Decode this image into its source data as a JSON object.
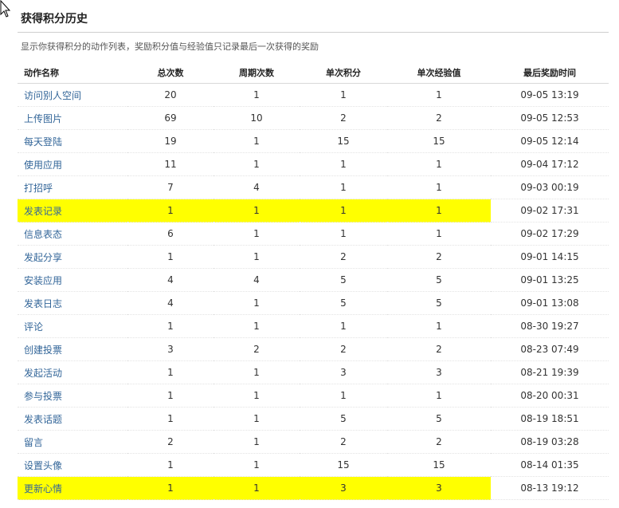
{
  "page": {
    "title": "获得积分历史",
    "subtitle": "显示你获得积分的动作列表，奖励积分值与经验值只记录最后一次获得的奖励"
  },
  "table": {
    "headers": {
      "action": "动作名称",
      "total": "总次数",
      "cycle": "周期次数",
      "points": "单次积分",
      "exp": "单次经验值",
      "last_time": "最后奖励时间"
    },
    "rows": [
      {
        "action": "访问别人空间",
        "total": "20",
        "cycle": "1",
        "points": "1",
        "exp": "1",
        "last_time": "09-05 13:19",
        "highlight": false
      },
      {
        "action": "上传图片",
        "total": "69",
        "cycle": "10",
        "points": "2",
        "exp": "2",
        "last_time": "09-05 12:53",
        "highlight": false
      },
      {
        "action": "每天登陆",
        "total": "19",
        "cycle": "1",
        "points": "15",
        "exp": "15",
        "last_time": "09-05 12:14",
        "highlight": false
      },
      {
        "action": "使用应用",
        "total": "11",
        "cycle": "1",
        "points": "1",
        "exp": "1",
        "last_time": "09-04 17:12",
        "highlight": false
      },
      {
        "action": "打招呼",
        "total": "7",
        "cycle": "4",
        "points": "1",
        "exp": "1",
        "last_time": "09-03 00:19",
        "highlight": false
      },
      {
        "action": "发表记录",
        "total": "1",
        "cycle": "1",
        "points": "1",
        "exp": "1",
        "last_time": "09-02 17:31",
        "highlight": true
      },
      {
        "action": "信息表态",
        "total": "6",
        "cycle": "1",
        "points": "1",
        "exp": "1",
        "last_time": "09-02 17:29",
        "highlight": false
      },
      {
        "action": "发起分享",
        "total": "1",
        "cycle": "1",
        "points": "2",
        "exp": "2",
        "last_time": "09-01 14:15",
        "highlight": false
      },
      {
        "action": "安装应用",
        "total": "4",
        "cycle": "4",
        "points": "5",
        "exp": "5",
        "last_time": "09-01 13:25",
        "highlight": false
      },
      {
        "action": "发表日志",
        "total": "4",
        "cycle": "1",
        "points": "5",
        "exp": "5",
        "last_time": "09-01 13:08",
        "highlight": false
      },
      {
        "action": "评论",
        "total": "1",
        "cycle": "1",
        "points": "1",
        "exp": "1",
        "last_time": "08-30 19:27",
        "highlight": false
      },
      {
        "action": "创建投票",
        "total": "3",
        "cycle": "2",
        "points": "2",
        "exp": "2",
        "last_time": "08-23 07:49",
        "highlight": false
      },
      {
        "action": "发起活动",
        "total": "1",
        "cycle": "1",
        "points": "3",
        "exp": "3",
        "last_time": "08-21 19:39",
        "highlight": false
      },
      {
        "action": "参与投票",
        "total": "1",
        "cycle": "1",
        "points": "1",
        "exp": "1",
        "last_time": "08-20 00:31",
        "highlight": false
      },
      {
        "action": "发表话题",
        "total": "1",
        "cycle": "1",
        "points": "5",
        "exp": "5",
        "last_time": "08-19 18:51",
        "highlight": false
      },
      {
        "action": "留言",
        "total": "2",
        "cycle": "1",
        "points": "2",
        "exp": "2",
        "last_time": "08-19 03:28",
        "highlight": false
      },
      {
        "action": "设置头像",
        "total": "1",
        "cycle": "1",
        "points": "15",
        "exp": "15",
        "last_time": "08-14 01:35",
        "highlight": false
      },
      {
        "action": "更新心情",
        "total": "1",
        "cycle": "1",
        "points": "3",
        "exp": "3",
        "last_time": "08-13 19:12",
        "highlight": true
      }
    ]
  },
  "colors": {
    "link": "#336699",
    "highlight": "#ffff00"
  },
  "icons": {
    "cursor": "mouse-pointer-icon"
  }
}
